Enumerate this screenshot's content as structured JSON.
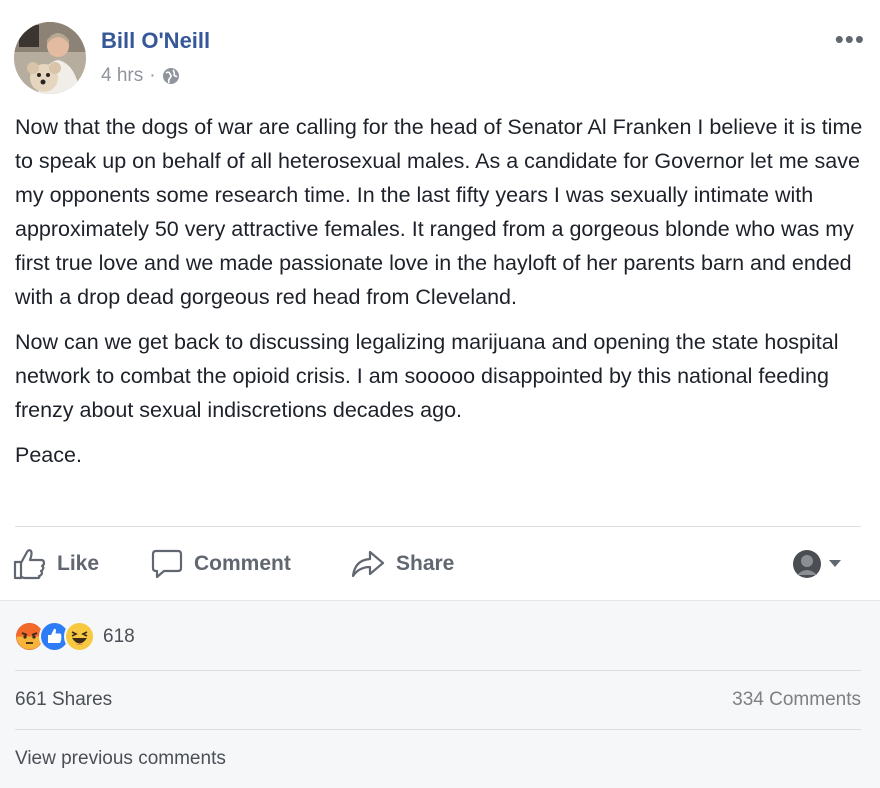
{
  "post": {
    "author": "Bill O'Neill",
    "time": "4 hrs",
    "meta_separator": "·",
    "privacy_icon": "globe-icon",
    "more_label": "•••",
    "paragraphs": [
      "Now that the dogs of war are calling for the head of Senator Al Franken I believe it is time to speak up on behalf of all heterosexual males. As a candidate for Governor let me save my opponents some research time. In the last fifty years I was sexually intimate with approximately 50 very attractive females. It ranged from a gorgeous blonde who was my first true love and we made passionate love in the hayloft of her parents barn and ended with a drop dead gorgeous red head from Cleveland.",
      "Now can we get back to discussing legalizing marijuana and opening the state hospital network to combat the opioid crisis. I am sooooo disappointed by this national feeding frenzy about sexual indiscretions decades ago.",
      "Peace."
    ]
  },
  "actions": {
    "like": "Like",
    "comment": "Comment",
    "share": "Share"
  },
  "footer": {
    "reaction_icons": [
      "angry-icon",
      "like-icon",
      "haha-icon"
    ],
    "reaction_count": "618",
    "shares": "661 Shares",
    "comments": "334 Comments",
    "view_previous": "View previous comments"
  },
  "colors": {
    "link_blue": "#365899",
    "text": "#1d2129",
    "muted": "#90949c",
    "action_gray": "#606770",
    "footer_bg": "#f6f7f9",
    "like_blue": "#2e7cf6",
    "angry_red": "#e9542b",
    "haha_yellow": "#f7c940"
  }
}
